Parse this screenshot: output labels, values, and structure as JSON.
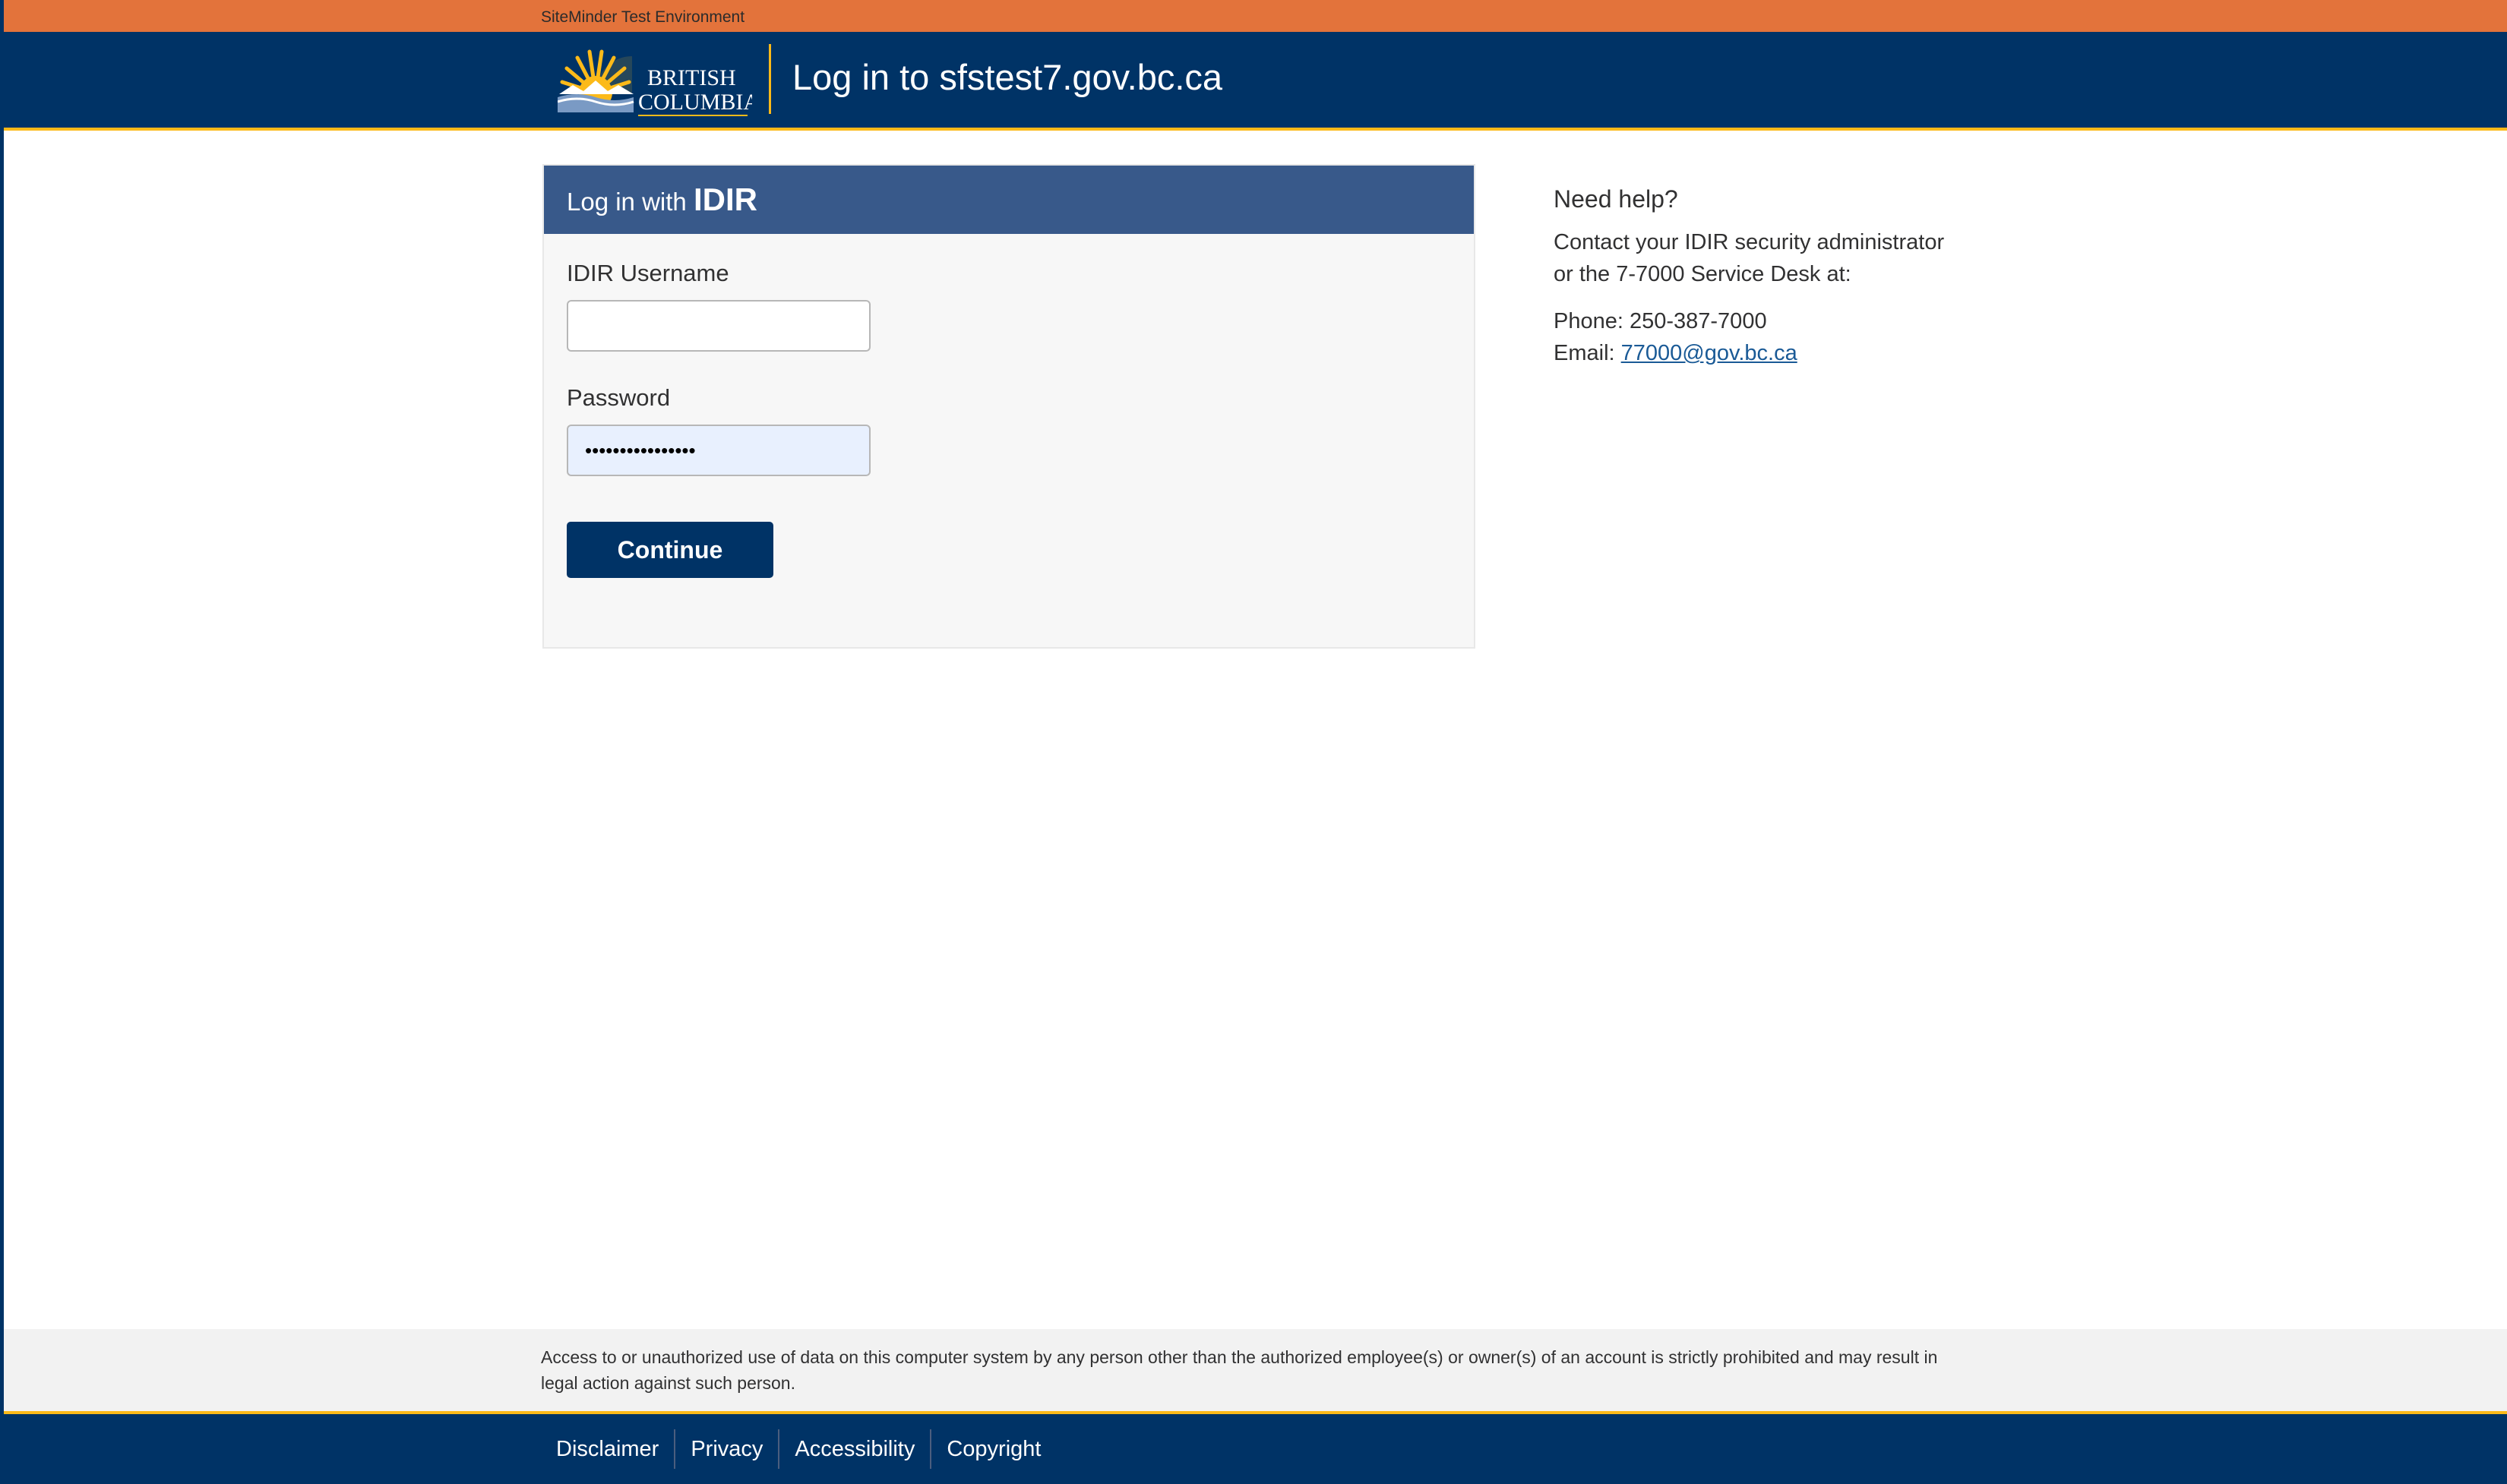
{
  "environment": {
    "label": "SiteMinder Test Environment"
  },
  "header": {
    "logo_line1": "BRITISH",
    "logo_line2": "COLUMBIA",
    "title": "Log in to sfstest7.gov.bc.ca"
  },
  "login": {
    "header_prefix": "Log in with",
    "header_brand": "IDIR",
    "username_label": "IDIR Username",
    "username_value": "",
    "password_label": "Password",
    "password_value": "••••••••••••••••",
    "continue_label": "Continue"
  },
  "help": {
    "title": "Need help?",
    "line1": "Contact your IDIR security administrator",
    "line2": "or the 7-7000 Service Desk at:",
    "phone": "Phone: 250-387-7000",
    "email_label": "Email:",
    "email": "77000@gov.bc.ca"
  },
  "notice": {
    "text": "Access to or unauthorized use of data on this computer system by any person other than the authorized employee(s) or owner(s) of an account is strictly prohibited and may result in legal action against such person."
  },
  "footer": {
    "links": [
      "Disclaimer",
      "Privacy",
      "Accessibility",
      "Copyright"
    ]
  },
  "colors": {
    "env_bar": "#e3733b",
    "header_bg": "#003366",
    "accent_gold": "#fcba19",
    "panel_header": "#38598a",
    "button_bg": "#003366",
    "link": "#1a5a96"
  }
}
